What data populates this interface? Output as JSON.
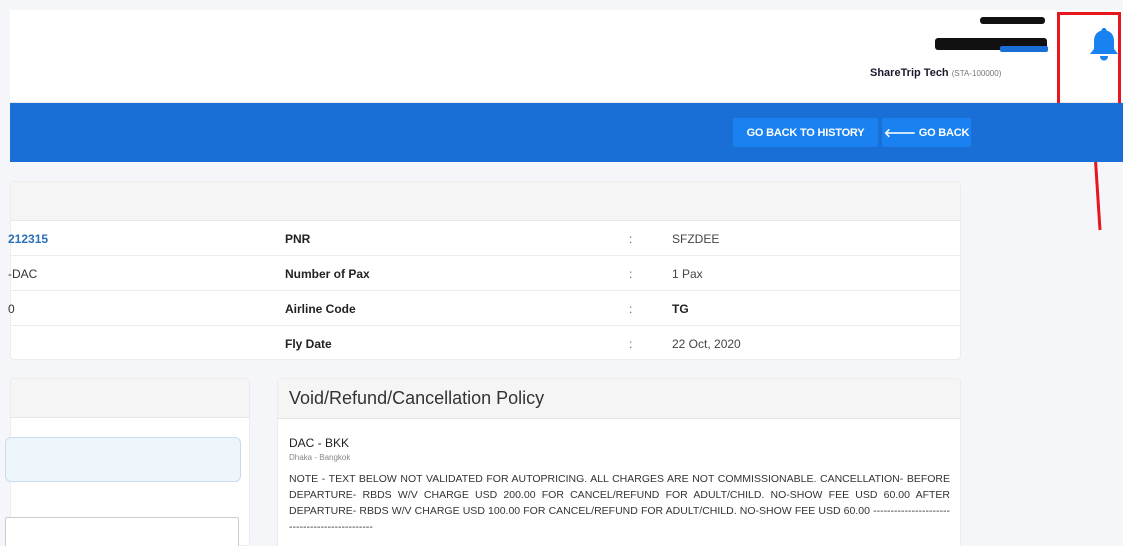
{
  "header": {
    "agency_name": "ShareTrip Tech",
    "agency_code": "(STA-100000)",
    "notification_icon": "bell-icon",
    "highlight_color": "#e8161d"
  },
  "nav": {
    "go_back_to_history": "GO BACK TO HISTORY",
    "go_back": "GO BACK",
    "go_back_arrow": "🡐",
    "bar_color": "#1a6fd6",
    "button_color": "#1a82f0"
  },
  "booking": {
    "rows": [
      {
        "left": "212315",
        "label": "PNR",
        "colon": ":",
        "value": "SFZDEE"
      },
      {
        "left": "-DAC",
        "label": "Number of Pax",
        "colon": ":",
        "value": "1 Pax"
      },
      {
        "left": "0",
        "label": "Airline Code",
        "colon": ":",
        "value": "TG"
      },
      {
        "left": "",
        "label": "Fly Date",
        "colon": ":",
        "value": "22 Oct, 2020"
      }
    ]
  },
  "policy": {
    "title": "Void/Refund/Cancellation Policy",
    "route": "DAC - BKK",
    "route_sub": "Dhaka - Bangkok",
    "text": "NOTE - TEXT BELOW NOT VALIDATED FOR AUTOPRICING. ALL CHARGES ARE NOT COMMISSIONABLE. CANCELLATION- BEFORE DEPARTURE- RBDS W/V CHARGE USD 200.00 FOR CANCEL/REFUND FOR ADULT/CHILD. NO-SHOW FEE USD 60.00 AFTER DEPARTURE- RBDS W/V CHARGE USD 100.00 FOR CANCEL/REFUND FOR ADULT/CHILD. NO-SHOW FEE USD 60.00 ----------------------------------------------"
  }
}
